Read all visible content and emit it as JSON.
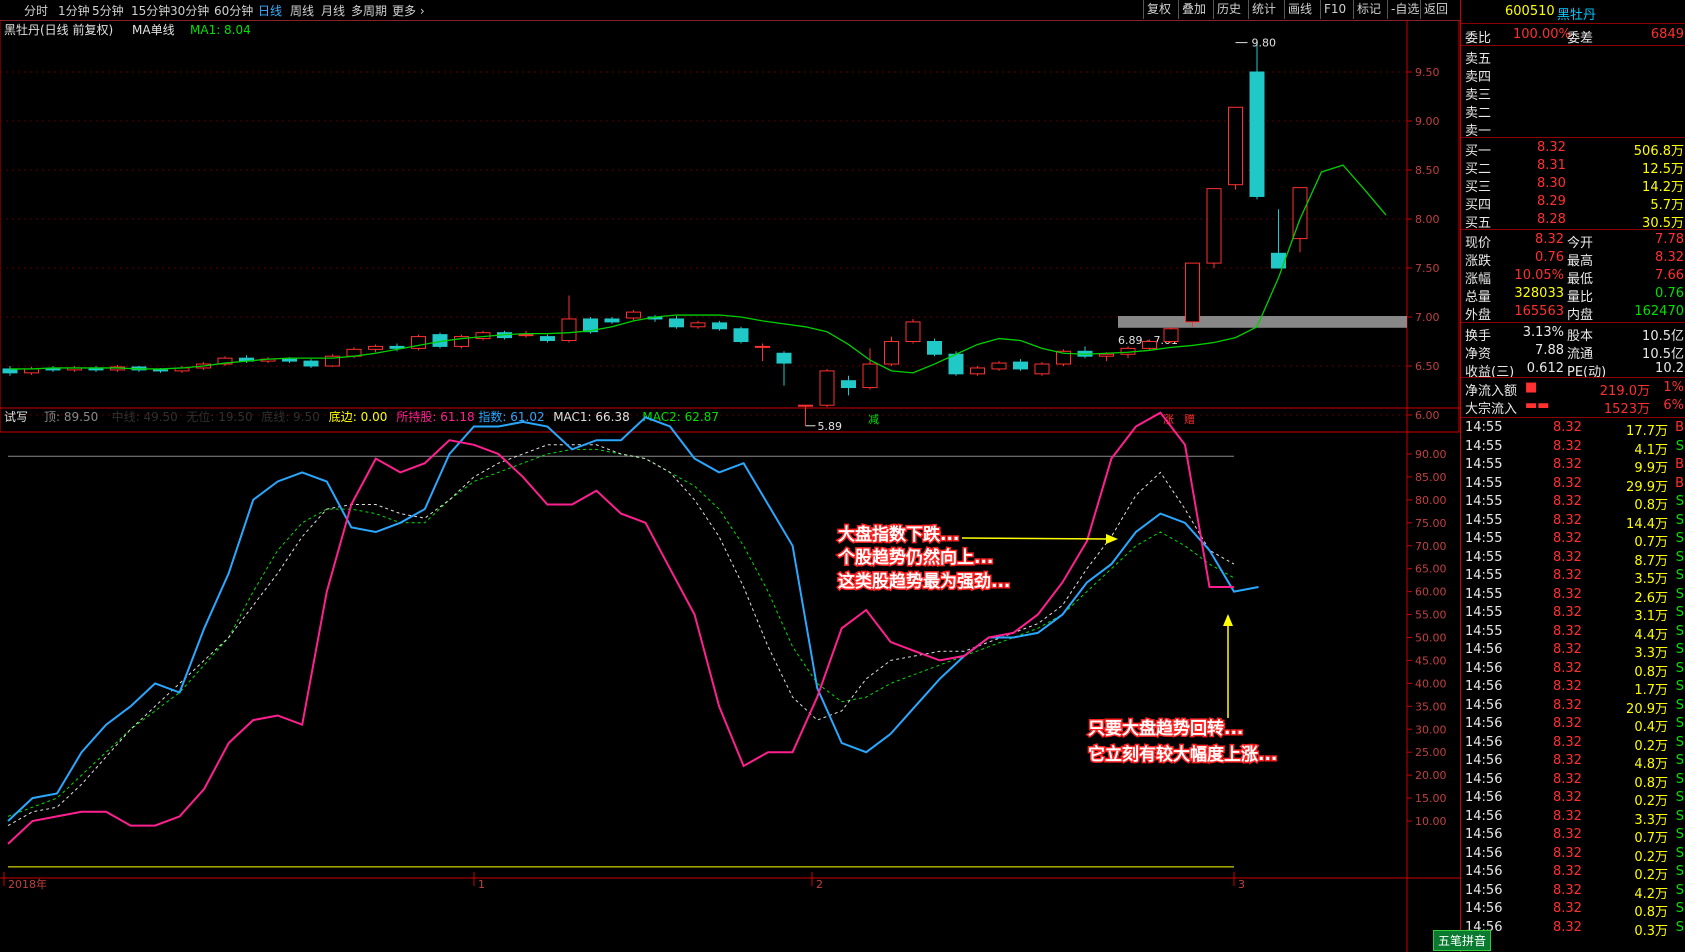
{
  "toolbar": {
    "periods": [
      "分时",
      "1分钟",
      "5分钟",
      "15分钟",
      "30分钟",
      "60分钟",
      "日线",
      "周线",
      "月线",
      "多周期",
      "更多 ›"
    ],
    "active": "日线",
    "buttons": [
      "复权",
      "叠加",
      "历史",
      "统计",
      "画线",
      "F10",
      "标记",
      "-自选",
      "返回"
    ]
  },
  "main_chart": {
    "title": "黑牡丹(日线 前复权)",
    "ma_label": "MA单线",
    "ma_value": "MA1: 8.04",
    "y_axis": [
      "9.50",
      "9.00",
      "8.50",
      "8.00",
      "7.50",
      "7.00",
      "6.50",
      "6.00"
    ],
    "high_marker": "9.80",
    "low_marker": "5.89",
    "range_label": "6.89 - 7.01",
    "event_labels": [
      "减",
      "涨",
      "赠"
    ]
  },
  "indicator": {
    "name": "试写",
    "legend": [
      {
        "label": "顶: 89.50",
        "color": "#8a8a8a"
      },
      {
        "label": "中线: 49.50",
        "color": "#303030"
      },
      {
        "label": "无位: 19.50",
        "color": "#303030"
      },
      {
        "label": "底线: 9.50",
        "color": "#303030"
      },
      {
        "label": "底边: 0.00",
        "color": "#ffff00"
      },
      {
        "label": "所持股: 61.18",
        "color": "#ff2090"
      },
      {
        "label": "指数: 61.02",
        "color": "#2aa8ff"
      },
      {
        "label": "MAC1: 66.38",
        "color": "#e0e0e0"
      },
      {
        "label": "MAC2: 62.87",
        "color": "#00e000"
      }
    ],
    "y_axis": [
      "90.00",
      "85.00",
      "80.00",
      "75.00",
      "70.00",
      "65.00",
      "60.00",
      "55.00",
      "50.00",
      "45.00",
      "40.00",
      "35.00",
      "30.00",
      "25.00",
      "20.00",
      "15.00",
      "10.00"
    ],
    "x_labels": [
      "2018年",
      "1",
      "2",
      "3"
    ],
    "annotation1": [
      "大盘指数下跌...",
      "个股趋势仍然向上...",
      "这类股趋势最为强劲..."
    ],
    "annotation2": [
      "只要大盘趋势回转...",
      "它立刻有较大幅度上涨..."
    ]
  },
  "chart_data": {
    "type": "line",
    "candles_note": "",
    "price": {
      "ma": [
        6.47,
        6.47,
        6.48,
        6.48,
        6.48,
        6.48,
        6.47,
        6.47,
        6.48,
        6.5,
        6.53,
        6.55,
        6.57,
        6.58,
        6.58,
        6.58,
        6.6,
        6.63,
        6.67,
        6.71,
        6.75,
        6.78,
        6.8,
        6.82,
        6.83,
        6.83,
        6.84,
        6.86,
        6.9,
        6.96,
        7.0,
        7.02,
        7.02,
        7.02,
        7.0,
        6.96,
        6.93,
        6.9,
        6.85,
        6.72,
        6.56,
        6.45,
        6.43,
        6.52,
        6.62,
        6.72,
        6.78,
        6.76,
        6.68,
        6.63,
        6.62,
        6.63,
        6.64,
        6.66,
        6.69,
        6.71,
        6.74,
        6.79,
        6.9,
        7.4,
        8.0,
        8.48,
        8.55,
        8.3,
        8.04
      ],
      "candles": [
        {
          "o": 6.47,
          "c": 6.43,
          "h": 6.5,
          "l": 6.4
        },
        {
          "o": 6.43,
          "c": 6.47,
          "h": 6.49,
          "l": 6.41
        },
        {
          "o": 6.47,
          "c": 6.46,
          "h": 6.5,
          "l": 6.44
        },
        {
          "o": 6.46,
          "c": 6.48,
          "h": 6.5,
          "l": 6.44
        },
        {
          "o": 6.48,
          "c": 6.46,
          "h": 6.5,
          "l": 6.44
        },
        {
          "o": 6.46,
          "c": 6.49,
          "h": 6.51,
          "l": 6.44
        },
        {
          "o": 6.49,
          "c": 6.46,
          "h": 6.5,
          "l": 6.44
        },
        {
          "o": 6.46,
          "c": 6.45,
          "h": 6.48,
          "l": 6.43
        },
        {
          "o": 6.45,
          "c": 6.48,
          "h": 6.5,
          "l": 6.43
        },
        {
          "o": 6.48,
          "c": 6.52,
          "h": 6.54,
          "l": 6.46
        },
        {
          "o": 6.52,
          "c": 6.58,
          "h": 6.6,
          "l": 6.5
        },
        {
          "o": 6.58,
          "c": 6.55,
          "h": 6.61,
          "l": 6.53
        },
        {
          "o": 6.55,
          "c": 6.57,
          "h": 6.59,
          "l": 6.53
        },
        {
          "o": 6.57,
          "c": 6.55,
          "h": 6.59,
          "l": 6.53
        },
        {
          "o": 6.55,
          "c": 6.5,
          "h": 6.57,
          "l": 6.48
        },
        {
          "o": 6.5,
          "c": 6.6,
          "h": 6.62,
          "l": 6.49
        },
        {
          "o": 6.6,
          "c": 6.67,
          "h": 6.69,
          "l": 6.58
        },
        {
          "o": 6.67,
          "c": 6.7,
          "h": 6.72,
          "l": 6.64
        },
        {
          "o": 6.7,
          "c": 6.68,
          "h": 6.73,
          "l": 6.65
        },
        {
          "o": 6.68,
          "c": 6.8,
          "h": 6.82,
          "l": 6.66
        },
        {
          "o": 6.82,
          "c": 6.7,
          "h": 6.84,
          "l": 6.68
        },
        {
          "o": 6.7,
          "c": 6.8,
          "h": 6.82,
          "l": 6.68
        },
        {
          "o": 6.78,
          "c": 6.84,
          "h": 6.86,
          "l": 6.76
        },
        {
          "o": 6.84,
          "c": 6.79,
          "h": 6.86,
          "l": 6.77
        },
        {
          "o": 6.82,
          "c": 6.82,
          "h": 6.86,
          "l": 6.79
        },
        {
          "o": 6.8,
          "c": 6.76,
          "h": 6.82,
          "l": 6.74
        },
        {
          "o": 6.76,
          "c": 6.98,
          "h": 7.22,
          "l": 6.74
        },
        {
          "o": 6.98,
          "c": 6.85,
          "h": 7.0,
          "l": 6.83
        },
        {
          "o": 6.98,
          "c": 6.95,
          "h": 7.0,
          "l": 6.93
        },
        {
          "o": 6.99,
          "c": 7.05,
          "h": 7.07,
          "l": 6.97
        },
        {
          "o": 7.0,
          "c": 6.98,
          "h": 7.02,
          "l": 6.95
        },
        {
          "o": 6.98,
          "c": 6.9,
          "h": 7.01,
          "l": 6.88
        },
        {
          "o": 6.9,
          "c": 6.94,
          "h": 6.96,
          "l": 6.88
        },
        {
          "o": 6.94,
          "c": 6.88,
          "h": 6.96,
          "l": 6.86
        },
        {
          "o": 6.88,
          "c": 6.75,
          "h": 6.9,
          "l": 6.73
        },
        {
          "o": 6.7,
          "c": 6.7,
          "h": 6.73,
          "l": 6.55
        },
        {
          "o": 6.63,
          "c": 6.53,
          "h": 6.65,
          "l": 6.3
        },
        {
          "o": 6.1,
          "c": 6.1,
          "h": 6.1,
          "l": 5.89
        },
        {
          "o": 6.1,
          "c": 6.45,
          "h": 6.47,
          "l": 6.08
        },
        {
          "o": 6.35,
          "c": 6.28,
          "h": 6.4,
          "l": 6.2
        },
        {
          "o": 6.28,
          "c": 6.52,
          "h": 6.68,
          "l": 6.26
        },
        {
          "o": 6.52,
          "c": 6.75,
          "h": 6.8,
          "l": 6.5
        },
        {
          "o": 6.75,
          "c": 6.95,
          "h": 6.98,
          "l": 6.73
        },
        {
          "o": 6.75,
          "c": 6.62,
          "h": 6.78,
          "l": 6.6
        },
        {
          "o": 6.62,
          "c": 6.42,
          "h": 6.65,
          "l": 6.4
        },
        {
          "o": 6.42,
          "c": 6.48,
          "h": 6.5,
          "l": 6.4
        },
        {
          "o": 6.47,
          "c": 6.53,
          "h": 6.55,
          "l": 6.45
        },
        {
          "o": 6.54,
          "c": 6.47,
          "h": 6.57,
          "l": 6.45
        },
        {
          "o": 6.42,
          "c": 6.52,
          "h": 6.54,
          "l": 6.4
        },
        {
          "o": 6.52,
          "c": 6.65,
          "h": 6.67,
          "l": 6.5
        },
        {
          "o": 6.65,
          "c": 6.6,
          "h": 6.7,
          "l": 6.58
        },
        {
          "o": 6.6,
          "c": 6.62,
          "h": 6.64,
          "l": 6.55
        },
        {
          "o": 6.62,
          "c": 6.68,
          "h": 6.7,
          "l": 6.58
        },
        {
          "o": 6.68,
          "c": 6.75,
          "h": 6.77,
          "l": 6.66
        },
        {
          "o": 6.75,
          "c": 6.88,
          "h": 6.9,
          "l": 6.73
        },
        {
          "o": 6.95,
          "c": 7.55,
          "h": 7.55,
          "l": 6.9
        },
        {
          "o": 7.55,
          "c": 8.31,
          "h": 8.31,
          "l": 7.5
        },
        {
          "o": 8.35,
          "c": 9.14,
          "h": 9.14,
          "l": 8.3
        },
        {
          "o": 9.5,
          "c": 8.23,
          "h": 9.8,
          "l": 8.2
        },
        {
          "o": 7.65,
          "c": 7.5,
          "h": 8.1,
          "l": 7.53
        },
        {
          "o": 7.8,
          "c": 8.32,
          "h": 8.32,
          "l": 7.66
        }
      ]
    },
    "series": [
      {
        "name": "所持股",
        "values": [
          5,
          10,
          11,
          12,
          12,
          9,
          9,
          11,
          17,
          27,
          32,
          33,
          31,
          60,
          79,
          89,
          86,
          88,
          93,
          92,
          90,
          85,
          79,
          79,
          82,
          77,
          75,
          65,
          55,
          35,
          22,
          25,
          25,
          37,
          52,
          56,
          49,
          47,
          45,
          46,
          50,
          51,
          55,
          62,
          71,
          89,
          96,
          99,
          92,
          61,
          61
        ]
      },
      {
        "name": "指数",
        "values": [
          10,
          15,
          16,
          25,
          31,
          35,
          40,
          38,
          52,
          64,
          80,
          84,
          86,
          84,
          74,
          73,
          75,
          78,
          90,
          96,
          96,
          97,
          96,
          91,
          93,
          93,
          98,
          96,
          89,
          86,
          88,
          79,
          70,
          39,
          27,
          25,
          29,
          35,
          41,
          46,
          50,
          50,
          51,
          55,
          62,
          66,
          73,
          77,
          75,
          69,
          60,
          61
        ]
      },
      {
        "name": "MAC1",
        "values": [
          9,
          12,
          13,
          18,
          24,
          30,
          35,
          40,
          45,
          50,
          57,
          64,
          72,
          78,
          79,
          79,
          77,
          76,
          80,
          85,
          88,
          90,
          92,
          92,
          92,
          90,
          89,
          86,
          80,
          72,
          61,
          48,
          37,
          32,
          34,
          41,
          45,
          46,
          47,
          47,
          49,
          51,
          53,
          57,
          65,
          72,
          81,
          86,
          78,
          69,
          66
        ]
      },
      {
        "name": "MAC2",
        "values": [
          11,
          13,
          15,
          20,
          25,
          30,
          34,
          38,
          44,
          50,
          60,
          69,
          75,
          78,
          78,
          77,
          75,
          75,
          80,
          84,
          86,
          88,
          90,
          91,
          91,
          90,
          89,
          86,
          83,
          78,
          70,
          60,
          48,
          40,
          36,
          37,
          40,
          42,
          44,
          46,
          48,
          50,
          52,
          55,
          60,
          65,
          70,
          73,
          70,
          66,
          63
        ]
      }
    ]
  },
  "right_panel": {
    "code": "600510",
    "name": "黑牡丹",
    "webi_label": "委比",
    "webi_value": "100.00%",
    "weicha_label": "委差",
    "weicha_value": "6849",
    "sell": [
      {
        "label": "卖五",
        "price": "",
        "vol": ""
      },
      {
        "label": "卖四",
        "price": "",
        "vol": ""
      },
      {
        "label": "卖三",
        "price": "",
        "vol": ""
      },
      {
        "label": "卖二",
        "price": "",
        "vol": ""
      },
      {
        "label": "卖一",
        "price": "",
        "vol": ""
      }
    ],
    "buy": [
      {
        "label": "买一",
        "price": "8.32",
        "vol": "506.8万"
      },
      {
        "label": "买二",
        "price": "8.31",
        "vol": "12.5万"
      },
      {
        "label": "买三",
        "price": "8.30",
        "vol": "14.2万"
      },
      {
        "label": "买四",
        "price": "8.29",
        "vol": "5.7万"
      },
      {
        "label": "买五",
        "price": "8.28",
        "vol": "30.5万"
      }
    ],
    "stats": [
      {
        "l1": "现价",
        "v1": "8.32",
        "c1": "red",
        "l2": "今开",
        "v2": "7.78",
        "c2": "red"
      },
      {
        "l1": "涨跌",
        "v1": "0.76",
        "c1": "red",
        "l2": "最高",
        "v2": "8.32",
        "c2": "red"
      },
      {
        "l1": "涨幅",
        "v1": "10.05%",
        "c1": "red",
        "l2": "最低",
        "v2": "7.66",
        "c2": "red"
      },
      {
        "l1": "总量",
        "v1": "328033",
        "c1": "yellow",
        "l2": "量比",
        "v2": "0.76",
        "c2": "green"
      },
      {
        "l1": "外盘",
        "v1": "165563",
        "c1": "red",
        "l2": "内盘",
        "v2": "162470",
        "c2": "green"
      }
    ],
    "stats2": [
      {
        "l1": "换手",
        "v1": "3.13%",
        "l2": "股本",
        "v2": "10.5亿"
      },
      {
        "l1": "净资",
        "v1": "7.88",
        "l2": "流通",
        "v2": "10.5亿"
      },
      {
        "l1": "收益(三)",
        "v1": "0.612",
        "l2": "PE(动)",
        "v2": "10.2"
      }
    ],
    "flow": [
      {
        "label": "净流入额",
        "value": "219.0万",
        "pct": "1%"
      },
      {
        "label": "大宗流入",
        "value": "1523万",
        "pct": "6%"
      }
    ],
    "ticks": [
      {
        "t": "14:55",
        "p": "8.32",
        "v": "17.7万",
        "s": "B"
      },
      {
        "t": "14:55",
        "p": "8.32",
        "v": "4.1万",
        "s": "S"
      },
      {
        "t": "14:55",
        "p": "8.32",
        "v": "9.9万",
        "s": "B"
      },
      {
        "t": "14:55",
        "p": "8.32",
        "v": "29.9万",
        "s": "B"
      },
      {
        "t": "14:55",
        "p": "8.32",
        "v": "0.8万",
        "s": "S"
      },
      {
        "t": "14:55",
        "p": "8.32",
        "v": "14.4万",
        "s": "S"
      },
      {
        "t": "14:55",
        "p": "8.32",
        "v": "0.7万",
        "s": "S"
      },
      {
        "t": "14:55",
        "p": "8.32",
        "v": "8.7万",
        "s": "S"
      },
      {
        "t": "14:55",
        "p": "8.32",
        "v": "3.5万",
        "s": "S"
      },
      {
        "t": "14:55",
        "p": "8.32",
        "v": "2.6万",
        "s": "S"
      },
      {
        "t": "14:55",
        "p": "8.32",
        "v": "3.1万",
        "s": "S"
      },
      {
        "t": "14:55",
        "p": "8.32",
        "v": "4.4万",
        "s": "S"
      },
      {
        "t": "14:56",
        "p": "8.32",
        "v": "3.3万",
        "s": "S"
      },
      {
        "t": "14:56",
        "p": "8.32",
        "v": "0.8万",
        "s": "S"
      },
      {
        "t": "14:56",
        "p": "8.32",
        "v": "1.7万",
        "s": "S"
      },
      {
        "t": "14:56",
        "p": "8.32",
        "v": "20.9万",
        "s": "S"
      },
      {
        "t": "14:56",
        "p": "8.32",
        "v": "0.4万",
        "s": "S"
      },
      {
        "t": "14:56",
        "p": "8.32",
        "v": "0.2万",
        "s": "S"
      },
      {
        "t": "14:56",
        "p": "8.32",
        "v": "4.8万",
        "s": "S"
      },
      {
        "t": "14:56",
        "p": "8.32",
        "v": "0.8万",
        "s": "S"
      },
      {
        "t": "14:56",
        "p": "8.32",
        "v": "0.2万",
        "s": "S"
      },
      {
        "t": "14:56",
        "p": "8.32",
        "v": "3.3万",
        "s": "S"
      },
      {
        "t": "14:56",
        "p": "8.32",
        "v": "0.7万",
        "s": "S"
      },
      {
        "t": "14:56",
        "p": "8.32",
        "v": "0.2万",
        "s": "S"
      },
      {
        "t": "14:56",
        "p": "8.32",
        "v": "0.2万",
        "s": "S"
      },
      {
        "t": "14:56",
        "p": "8.32",
        "v": "4.2万",
        "s": "S"
      },
      {
        "t": "14:56",
        "p": "8.32",
        "v": "0.8万",
        "s": "S"
      },
      {
        "t": "14:56",
        "p": "8.32",
        "v": "0.3万",
        "s": "S"
      }
    ],
    "ime": "五笔拼音"
  }
}
